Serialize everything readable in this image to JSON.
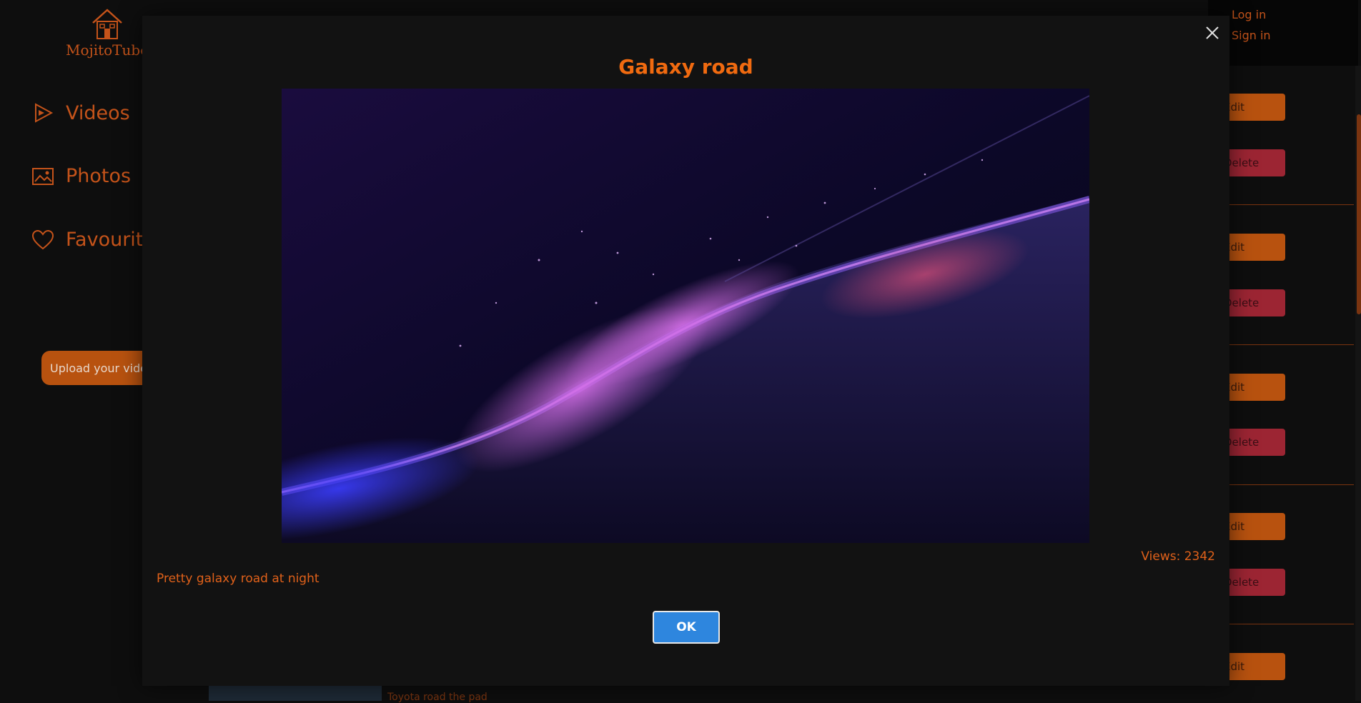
{
  "app": {
    "logo_text": "MojitoTube"
  },
  "sidebar": {
    "items": [
      {
        "label": "Videos",
        "icon": "play-icon"
      },
      {
        "label": "Photos",
        "icon": "image-icon"
      },
      {
        "label": "Favourites",
        "icon": "heart-icon"
      }
    ],
    "upload_label": "Upload your video"
  },
  "header": {
    "login_label": "Log in",
    "signin_label": "Sign in"
  },
  "list": {
    "edit_label": "Edit",
    "delete_label": "Delete",
    "partial_caption": "Toyota road the pad"
  },
  "modal": {
    "title": "Galaxy road",
    "views_text": "Views: 2342",
    "description": "Pretty galaxy road at night",
    "ok_label": "OK",
    "close_icon": "close-icon"
  },
  "colors": {
    "accent": "#f06a10",
    "edit": "#b8520f",
    "delete": "#9c2533",
    "ok": "#2e86de"
  }
}
